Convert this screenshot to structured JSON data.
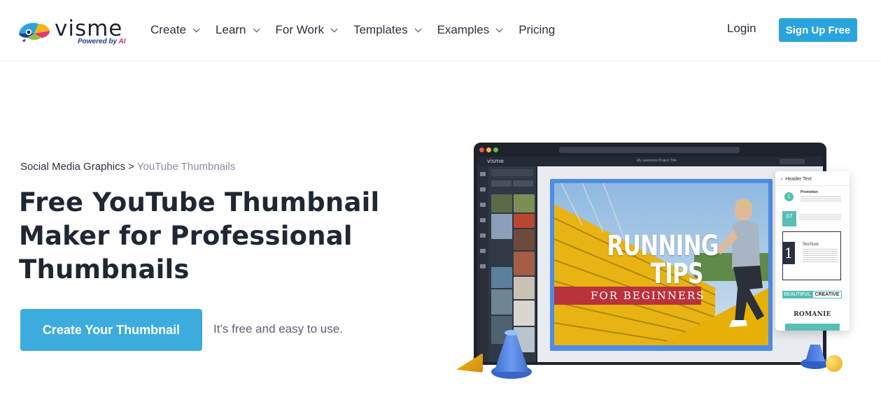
{
  "nav": {
    "logo_word": "visme",
    "logo_tag_prefix": "Powered by ",
    "logo_tag_ai": "AI",
    "items": [
      {
        "label": "Create",
        "has_dropdown": true
      },
      {
        "label": "Learn",
        "has_dropdown": true
      },
      {
        "label": "For Work",
        "has_dropdown": true
      },
      {
        "label": "Templates",
        "has_dropdown": true
      },
      {
        "label": "Examples",
        "has_dropdown": true
      },
      {
        "label": "Pricing",
        "has_dropdown": false
      }
    ],
    "login_label": "Login",
    "signup_label": "Sign Up Free"
  },
  "hero": {
    "breadcrumb": {
      "parent": "Social Media Graphics",
      "separator": ">",
      "current": "YouTube Thumbnails"
    },
    "title": "Free YouTube Thumbnail Maker for Professional Thumbnails",
    "cta_label": "Create Your Thumbnail",
    "cta_note": "It’s free and easy to use."
  },
  "mockup": {
    "app_brand": "visme",
    "project_title": "My awesome Project Title",
    "thumbnail_line1": "RUNNING",
    "thumbnail_line2": "TIPS",
    "thumbnail_banner": "FOR BEGINNERS",
    "side_panel": {
      "header": "Header Text",
      "promo_number": "1",
      "promo_title": "Promotion",
      "date_number": "07",
      "section_number": "1",
      "section_title": "Section",
      "beautiful": "BEAUTIFUL",
      "creative": "CREATIVE",
      "romanie": "ROMANIE"
    }
  },
  "colors": {
    "accent_button": "#2ba4de",
    "cta_button": "#3bacdd",
    "heading": "#1f2734",
    "breadcrumb_current": "#8790a0",
    "banner_red": "#b8333c",
    "teal": "#57bfb5"
  }
}
